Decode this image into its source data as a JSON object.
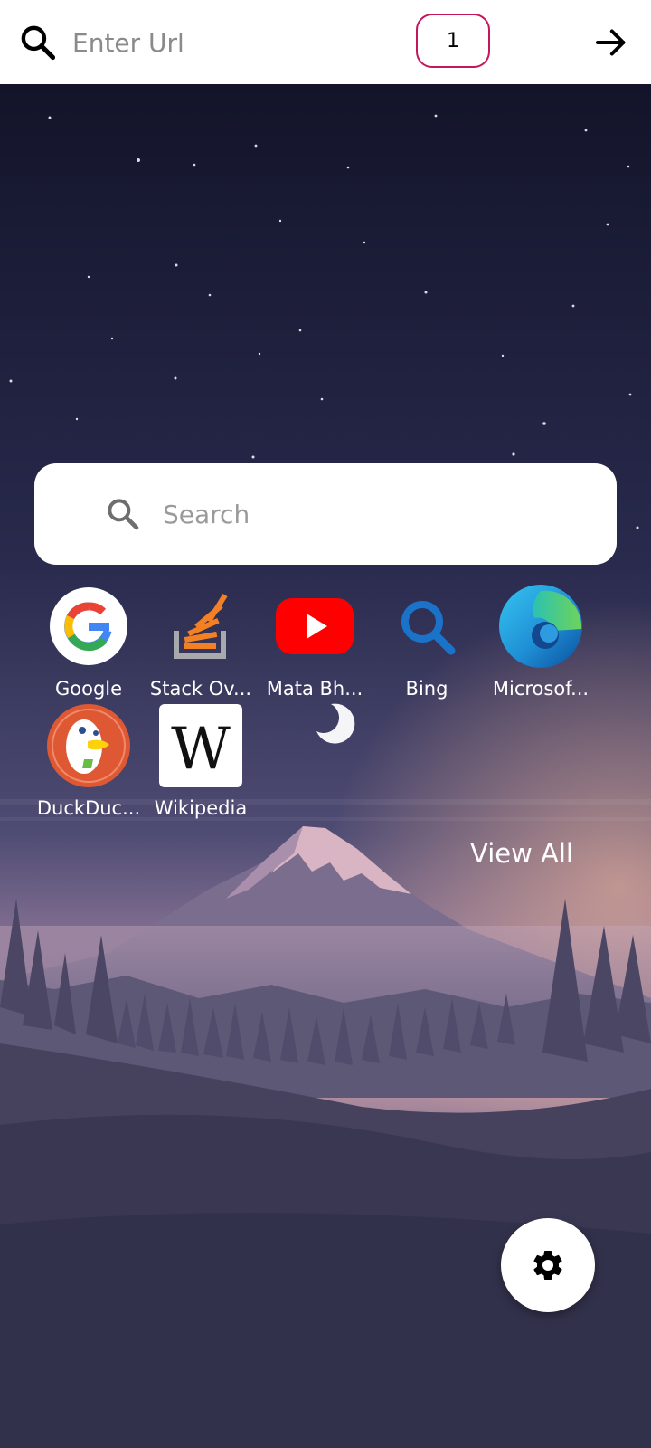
{
  "topbar": {
    "search_icon": "search-icon",
    "url_placeholder": "Enter Url",
    "tab_count": "1",
    "go_icon": "arrow-right-icon"
  },
  "search": {
    "icon": "search-icon",
    "placeholder": "Search"
  },
  "shortcuts": [
    {
      "label": "Google",
      "icon": "google-icon"
    },
    {
      "label": "Stack Ov...",
      "icon": "stackoverflow-icon"
    },
    {
      "label": "Mata Bh...",
      "icon": "youtube-icon"
    },
    {
      "label": "Bing",
      "icon": "bing-icon"
    },
    {
      "label": "Microsof...",
      "icon": "edge-icon"
    },
    {
      "label": "DuckDuc...",
      "icon": "duckduckgo-icon"
    },
    {
      "label": "Wikipedia",
      "icon": "wikipedia-icon"
    }
  ],
  "view_all_label": "View All",
  "settings": {
    "icon": "gear-icon"
  },
  "colors": {
    "tab_border": "#c2185b",
    "sky_top": "#14152b",
    "sky_mid": "#3a3b63",
    "dusk": "#e2a6a0",
    "ground": "#2f2f47"
  }
}
